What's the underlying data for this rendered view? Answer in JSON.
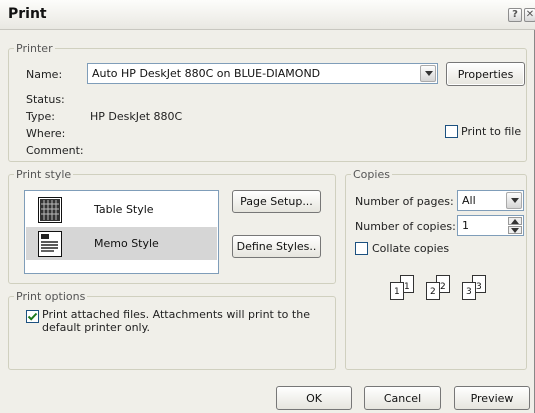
{
  "dialog": {
    "title": "Print"
  },
  "titlebar": {
    "help_glyph": "?",
    "close_glyph": "✕"
  },
  "printer": {
    "legend": "Printer",
    "name_label": "Name:",
    "name_value": "Auto HP DeskJet 880C on BLUE-DIAMOND",
    "properties_label": "Properties",
    "status_label": "Status:",
    "type_label": "Type:",
    "type_value": "HP DeskJet 880C",
    "where_label": "Where:",
    "comment_label": "Comment:",
    "print_to_file_label": "Print to file",
    "print_to_file_checked": false
  },
  "print_style": {
    "legend": "Print style",
    "styles": [
      {
        "name": "Table Style",
        "icon": "table-style-icon",
        "selected": false
      },
      {
        "name": "Memo Style",
        "icon": "memo-style-icon",
        "selected": true
      }
    ],
    "page_setup_label": "Page Setup...",
    "define_styles_label": "Define Styles.."
  },
  "copies": {
    "legend": "Copies",
    "pages_label": "Number of pages:",
    "pages_value": "All",
    "copies_label": "Number of copies:",
    "copies_value": "1",
    "collate_label": "Collate copies",
    "collate_checked": false,
    "collate_pages": [
      "1",
      "1",
      "2",
      "2",
      "3",
      "3"
    ]
  },
  "print_options": {
    "legend": "Print options",
    "attached_label_line1": "Print attached files.  Attachments will print to the",
    "attached_label_line2": "default printer only.",
    "attached_checked": true
  },
  "footer": {
    "ok_label": "OK",
    "cancel_label": "Cancel",
    "preview_label": "Preview"
  },
  "colors": {
    "dialog_bg": "#f0efe9",
    "field_border": "#7f9db9",
    "selected_row": "#d6d6d6"
  }
}
